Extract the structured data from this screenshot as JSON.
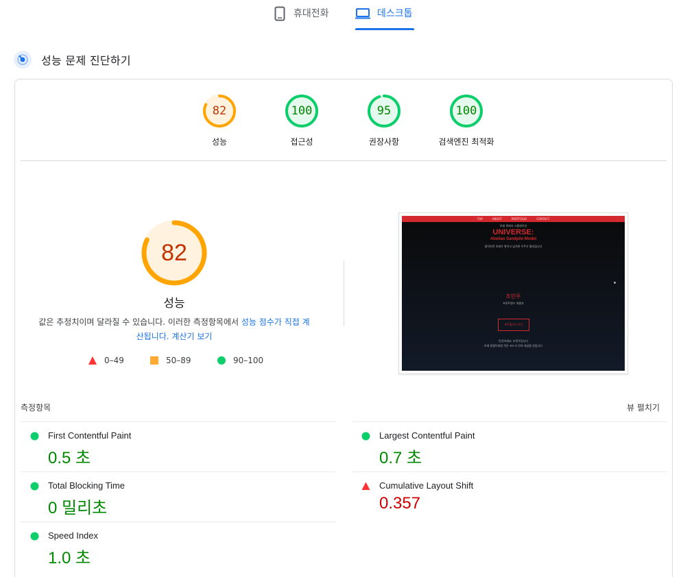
{
  "tabs": [
    {
      "label": "휴대전화",
      "icon": "phone-icon",
      "active": false
    },
    {
      "label": "데스크톱",
      "icon": "laptop-icon",
      "active": true
    }
  ],
  "diagnose": {
    "title": "성능 문제 진단하기",
    "icon": "pagespeed-icon"
  },
  "categories": [
    {
      "score": "82",
      "label": "성능",
      "status": "average"
    },
    {
      "score": "100",
      "label": "접근성",
      "status": "pass"
    },
    {
      "score": "95",
      "label": "권장사항",
      "status": "pass"
    },
    {
      "score": "100",
      "label": "검색엔진 최적화",
      "status": "pass"
    }
  ],
  "performance": {
    "score": "82",
    "label": "성능",
    "note_prefix": "값은 추정치이며 달라질 수 있습니다. 이러한 측정항목에서 ",
    "note_link1": "성능 점수가 직접 계산됩니다.",
    "note_link2": "계산기 보기"
  },
  "legend": [
    {
      "range": "0–49",
      "shape": "triangle",
      "color": "#ff3333"
    },
    {
      "range": "50–89",
      "shape": "square",
      "color": "#ffaa33"
    },
    {
      "range": "90–100",
      "shape": "circle",
      "color": "#0cce6b"
    }
  ],
  "thumbnail": {
    "nav": [
      "TOP",
      "ABOUT",
      "PORTFOLIO",
      "CONTACT"
    ],
    "kicker": "모래 위에서 시뮬레이션",
    "hero": "UNIVERSE:",
    "subtitle": "Abelian Sandpile Model",
    "desc": "클릭하면 모래가 쌓이고 넘치며 우주가 펼쳐집니다",
    "name": "조민우",
    "role": "프론트엔드 개발자",
    "button": "포트폴리오 보기",
    "footer1": "안녕하세요, 조민우입니다",
    "footer2": "모래 알갱이처럼 작은 코드가 모여 세상을 만듭니다"
  },
  "metrics": {
    "title": "측정항목",
    "expand_label": "뷰 펼치기",
    "items": [
      {
        "name": "First Contentful Paint",
        "value": "0.5 초",
        "status": "good"
      },
      {
        "name": "Largest Contentful Paint",
        "value": "0.7 초",
        "status": "good"
      },
      {
        "name": "Total Blocking Time",
        "value": "0 밀리초",
        "status": "good"
      },
      {
        "name": "Cumulative Layout Shift",
        "value": "0.357",
        "status": "bad"
      },
      {
        "name": "Speed Index",
        "value": "1.0 초",
        "status": "good"
      }
    ]
  },
  "colors": {
    "accent": "#1a73e8",
    "pass": "#0cce6b",
    "average": "#ffa400",
    "fail": "#ff3333",
    "pass_text": "#008800",
    "average_text": "#c33300",
    "fail_text": "#cc0000"
  }
}
